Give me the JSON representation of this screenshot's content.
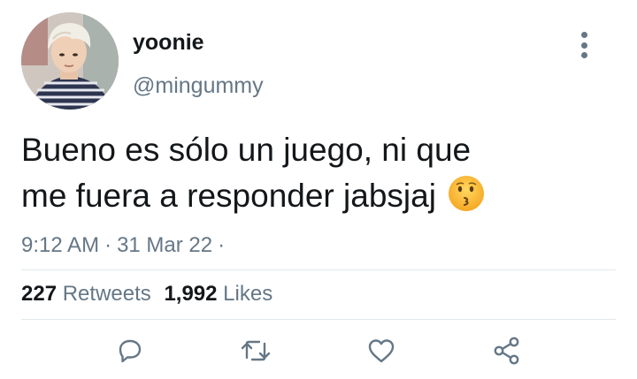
{
  "user": {
    "display_name": "yoonie",
    "handle": "@mingummy",
    "avatar_icon": "avatar-photo"
  },
  "tweet": {
    "text_line1": "Bueno es sólo un juego, ni que",
    "text_line2": "me fuera a responder jabsjaj",
    "emoji": "kissing-face-emoji",
    "time": "9:12 AM",
    "date": "31 Mar 22",
    "sep": "·"
  },
  "stats": {
    "retweets_count": "227",
    "retweets_label": "Retweets",
    "likes_count": "1,992",
    "likes_label": "Likes"
  },
  "actions": [
    "reply-icon",
    "retweet-icon",
    "like-icon",
    "share-icon"
  ],
  "colors": {
    "text": "#14171a",
    "secondary": "#657786",
    "divider": "#e1e8ed"
  }
}
